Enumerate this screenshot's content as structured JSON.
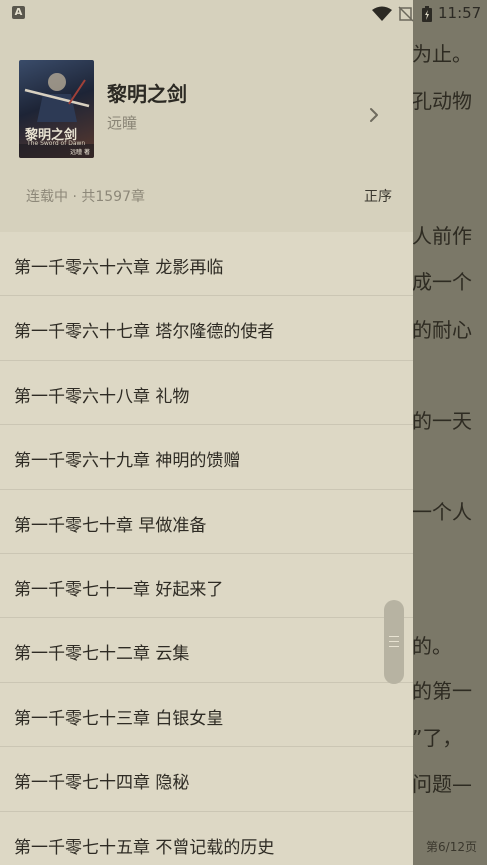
{
  "status_bar": {
    "time": "11:57",
    "app_icon_letter": "A",
    "icons": [
      "app-notification-icon",
      "wifi-icon",
      "no-sim-icon",
      "battery-charging-icon"
    ]
  },
  "reader_background": {
    "lines": [
      "为止。",
      "孔动物",
      "人前作",
      "成一个",
      "的耐心",
      "的一天",
      "一个人",
      "的。",
      "的第一",
      "”了，",
      "问题—"
    ],
    "page_indicator": "第6/12页"
  },
  "book": {
    "title": "黎明之剑",
    "author": "远瞳",
    "cover_title": "黎明之剑",
    "cover_subtitle": "The Sword of Dawn",
    "cover_author": "远瞳 著",
    "status": "连载中 · 共1597章",
    "sort_label": "正序"
  },
  "chapters": [
    "第一千零六十六章 龙影再临",
    "第一千零六十七章 塔尔隆德的使者",
    "第一千零六十八章 礼物",
    "第一千零六十九章 神明的馈赠",
    "第一千零七十章 早做准备",
    "第一千零七十一章 好起来了",
    "第一千零七十二章 云集",
    "第一千零七十三章 白银女皇",
    "第一千零七十四章 隐秘",
    "第一千零七十五章 不曾记载的历史"
  ],
  "colors": {
    "drawer_background": "#ddd8c5",
    "header_background": "#d6d1bd",
    "text_primary": "#2e2b24",
    "text_secondary": "#8a8576"
  }
}
